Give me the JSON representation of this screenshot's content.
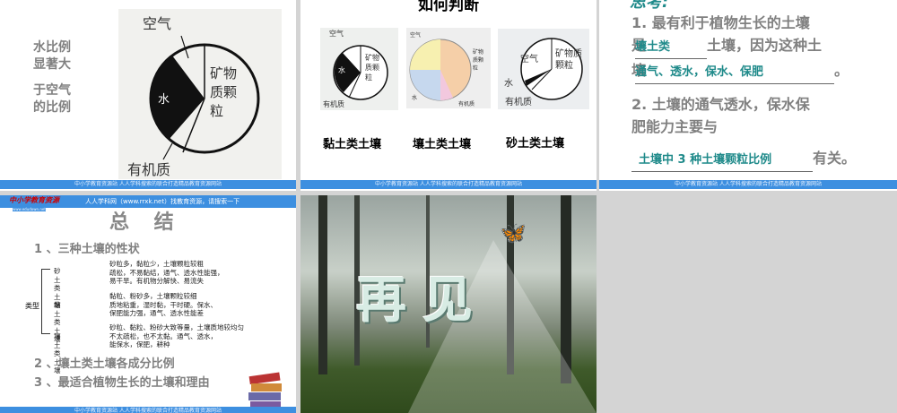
{
  "footer_text": "中小学教育资源站 人人学科搜索的联合打造精品教育资源网站",
  "slide1": {
    "side_text": [
      "水比例",
      "显著大",
      "于空气",
      "的比例"
    ],
    "pie_labels": {
      "air": "空气",
      "water": "水",
      "mineral": "矿物质颗粒",
      "organic": "有机质"
    }
  },
  "slide2": {
    "title": "如何判断",
    "captions": [
      "黏土类土壤",
      "壤土类土壤",
      "砂土类土壤"
    ],
    "labels": {
      "air": "空气",
      "water": "水",
      "mineral": "矿物质颗粒",
      "organic": "有机质"
    }
  },
  "slide3": {
    "title": "思考:",
    "q1_a": "1. 最有利于植物生长的土壤",
    "q1_b": "是",
    "blank1": "壤土类",
    "q1_c": "土壤，因为这种土",
    "q1_d": "壤",
    "blank2": "通气、透水，保水、保肥",
    "q1_end": "。",
    "q2_a": "2. 土壤的通气透水，保水保",
    "q2_b": "肥能力主要与",
    "blank3": "土壤中 3 种土壤颗粒比例",
    "q2_end": "有关。"
  },
  "slide4": {
    "header_logo": "中小学教育资源",
    "header_sub": "www.edudown.net",
    "header_text": "人人学科网（www.rrxk.net）找教育资源，请搜索一下",
    "title": "总  结",
    "point1": "1 、三种土壤的性状",
    "root": "类型",
    "types": [
      {
        "name": "砂土类土壤",
        "lines": [
          "砂粒多，黏粒少，土壤颗粒较粗",
          "疏松，不易黏结，通气、透水性能强，",
          "易干旱。有机物分解快、易流失"
        ]
      },
      {
        "name": "黏土类土壤",
        "lines": [
          "黏粒、粉砂多，土壤颗粒较细",
          "质地粘重，湿时黏，干时硬。保水、",
          "保肥能力强，通气、透水性能差"
        ]
      },
      {
        "name": "壤土类土壤",
        "lines": [
          "砂粒、黏粒、粉砂大致等量，土壤质地较均匀",
          "不太疏松，也不太黏。通气、透水，",
          "能保水，保肥，耕种"
        ]
      }
    ],
    "point2": "2 、壤土类土壤各成分比例",
    "point3": "3 、最适合植物生长的土壤和理由"
  },
  "slide5": {
    "text": "再见"
  },
  "colors": {
    "footer": "#3d8fe0",
    "teal": "#1f8a8a",
    "gray_text": "#808080"
  }
}
